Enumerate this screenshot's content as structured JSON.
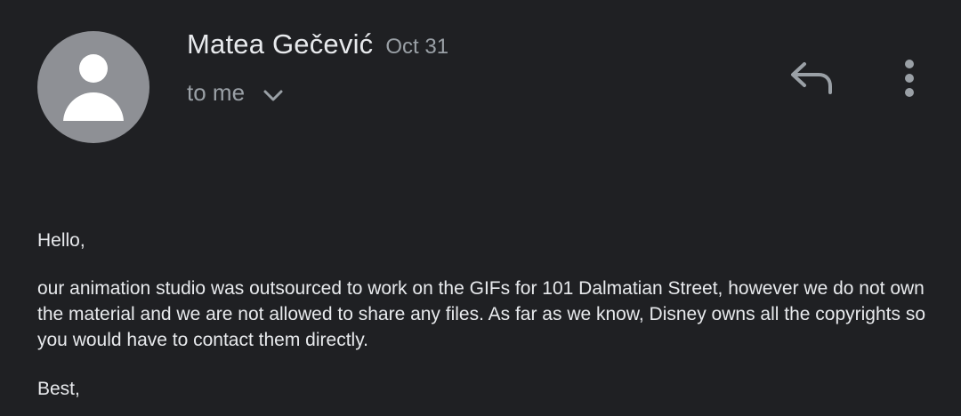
{
  "email": {
    "sender": {
      "name": "Matea Gečević",
      "date": "Oct 31",
      "avatar_icon": "person-icon"
    },
    "recipient": {
      "label": "to me",
      "expand_icon": "chevron-down-icon"
    },
    "actions": {
      "reply_icon": "reply-icon",
      "more_icon": "more-vertical-icon"
    },
    "body": {
      "greeting": "Hello,",
      "paragraph": "our animation studio was outsourced to work on the GIFs for 101 Dalmatian Street, however we do not own the material and we are not allowed to share any files. As far as we know, Disney owns all the copyrights so you would have to contact them directly.",
      "closing": "Best,"
    }
  },
  "colors": {
    "background": "#1f2023",
    "primary_text": "#e8eaed",
    "secondary_text": "#9aa0a6",
    "avatar_bg": "#8e9095",
    "avatar_figure": "#ffffff"
  }
}
